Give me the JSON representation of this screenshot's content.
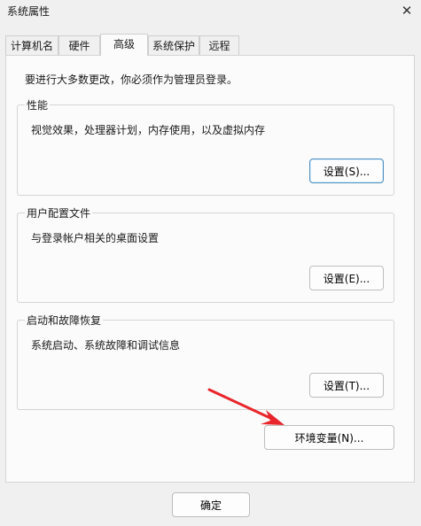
{
  "window": {
    "title": "系统属性",
    "close_glyph": "✕"
  },
  "tabs": [
    {
      "label": "计算机名"
    },
    {
      "label": "硬件"
    },
    {
      "label": "高级",
      "active": true
    },
    {
      "label": "系统保护"
    },
    {
      "label": "远程"
    }
  ],
  "advanced": {
    "admin_note": "要进行大多数更改，你必须作为管理员登录。",
    "performance": {
      "title": "性能",
      "description": "视觉效果，处理器计划，内存使用，以及虚拟内存",
      "button": "设置(S)..."
    },
    "user_profiles": {
      "title": "用户配置文件",
      "description": "与登录帐户相关的桌面设置",
      "button": "设置(E)..."
    },
    "startup_recovery": {
      "title": "启动和故障恢复",
      "description": "系统启动、系统故障和调试信息",
      "button": "设置(T)..."
    },
    "env_button": "环境变量(N)..."
  },
  "footer": {
    "ok_button": "确定"
  },
  "annotation": {
    "arrow_color": "#e8262b"
  }
}
